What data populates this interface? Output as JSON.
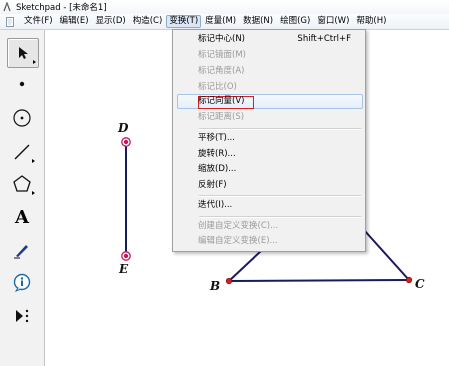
{
  "window": {
    "title": "Sketchpad - [未命名1]",
    "app_icon": "sketchpad-compass-icon"
  },
  "menubar": {
    "doc_icon": "document-icon",
    "items": [
      {
        "label": "文件(F)"
      },
      {
        "label": "编辑(E)"
      },
      {
        "label": "显示(D)"
      },
      {
        "label": "构造(C)"
      },
      {
        "label": "变换(T)",
        "active": true
      },
      {
        "label": "度量(M)"
      },
      {
        "label": "数据(N)"
      },
      {
        "label": "绘图(G)"
      },
      {
        "label": "窗口(W)"
      },
      {
        "label": "帮助(H)"
      }
    ]
  },
  "toolbox": {
    "tools": [
      {
        "name": "selection-arrow-tool-icon",
        "selected": true
      },
      {
        "name": "point-tool-icon"
      },
      {
        "name": "compass-tool-icon"
      },
      {
        "name": "straightedge-tool-icon"
      },
      {
        "name": "polygon-tool-icon"
      },
      {
        "name": "text-tool-icon",
        "glyph": "A"
      },
      {
        "name": "marker-tool-icon"
      },
      {
        "name": "information-tool-icon"
      },
      {
        "name": "custom-tool-icon"
      }
    ]
  },
  "dropdown": {
    "items": [
      {
        "label": "标记中心(N)",
        "shortcut": "Shift+Ctrl+F",
        "disabled": false
      },
      {
        "label": "标记镜面(M)",
        "disabled": true
      },
      {
        "label": "标记角度(A)",
        "disabled": true
      },
      {
        "label": "标记比(O)",
        "disabled": true
      },
      {
        "label": "标记向量(V)",
        "disabled": false,
        "hovered": true,
        "outlined": true
      },
      {
        "label": "标记距离(S)",
        "disabled": true
      },
      {
        "label": "平移(T)...",
        "disabled": false
      },
      {
        "label": "旋转(R)...",
        "disabled": false
      },
      {
        "label": "缩放(D)...",
        "disabled": false
      },
      {
        "label": "反射(F)",
        "disabled": false
      },
      {
        "label": "迭代(I)...",
        "disabled": false
      },
      {
        "label": "创建自定义变换(C)...",
        "disabled": true
      },
      {
        "label": "编辑自定义变换(E)...",
        "disabled": true
      }
    ]
  },
  "canvas": {
    "points": [
      {
        "label": "D"
      },
      {
        "label": "E"
      },
      {
        "label": "B"
      },
      {
        "label": "C"
      }
    ],
    "colors": {
      "segment": "#1a1a5e",
      "selected_point": "#c2185b",
      "point": "#d42020",
      "highlight_box": "#d92020"
    }
  }
}
